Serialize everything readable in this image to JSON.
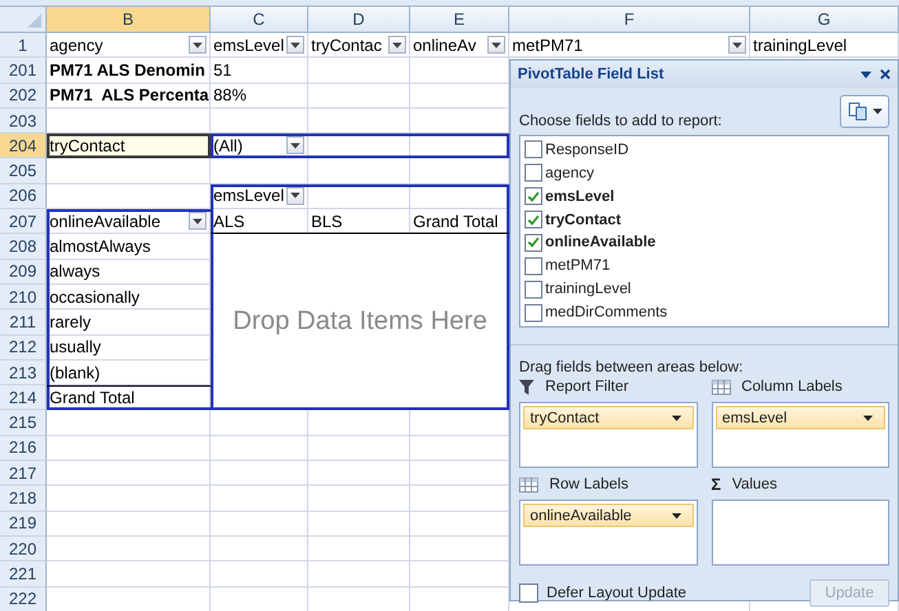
{
  "sheet": {
    "columns": [
      {
        "label": "B"
      },
      {
        "label": "C"
      },
      {
        "label": "D"
      },
      {
        "label": "E"
      },
      {
        "label": "F"
      },
      {
        "label": "G"
      }
    ],
    "rows": [
      {
        "number": "1",
        "cells": [
          {
            "text": "agency",
            "bold": false,
            "dropdown": true,
            "selected": false
          },
          {
            "text": "emsLevel",
            "bold": false,
            "dropdown": true,
            "selected": false
          },
          {
            "text": "tryContac",
            "bold": false,
            "dropdown": true,
            "selected": false
          },
          {
            "text": "onlineAv",
            "bold": false,
            "dropdown": true,
            "selected": false
          },
          {
            "text": "metPM71",
            "bold": false,
            "dropdown": true,
            "selected": false
          },
          {
            "text": "trainingLevel",
            "bold": false,
            "dropdown": false,
            "selected": false
          }
        ]
      },
      {
        "number": "201",
        "cells": [
          {
            "text": "PM71 ALS Denomin",
            "bold": true,
            "dropdown": false,
            "selected": false
          },
          {
            "text": "51",
            "bold": false,
            "dropdown": false,
            "selected": false
          }
        ]
      },
      {
        "number": "202",
        "cells": [
          {
            "text": "PM71  ALS Percenta",
            "bold": true,
            "dropdown": false,
            "selected": false
          },
          {
            "text": "88%",
            "bold": false,
            "dropdown": false,
            "selected": false
          }
        ]
      },
      {
        "number": "203",
        "cells": []
      },
      {
        "number": "204",
        "cells": [
          {
            "text": "tryContact",
            "bold": false,
            "dropdown": false,
            "selected": true
          },
          {
            "text": "(All)",
            "bold": false,
            "dropdown": true,
            "selected": false
          }
        ]
      },
      {
        "number": "205",
        "cells": []
      },
      {
        "number": "206",
        "cells": [
          null,
          {
            "text": "emsLevel",
            "bold": false,
            "dropdown": true,
            "selected": false
          }
        ]
      },
      {
        "number": "207",
        "cells": [
          {
            "text": "onlineAvailable",
            "bold": false,
            "dropdown": true,
            "selected": false
          },
          {
            "text": "ALS",
            "bold": false,
            "dropdown": false,
            "selected": false
          },
          {
            "text": "BLS",
            "bold": false,
            "dropdown": false,
            "selected": false
          },
          {
            "text": "Grand Total",
            "bold": false,
            "dropdown": false,
            "selected": false
          }
        ]
      },
      {
        "number": "208",
        "cells": [
          {
            "text": "almostAlways",
            "bold": false,
            "dropdown": false,
            "selected": false
          }
        ]
      },
      {
        "number": "209",
        "cells": [
          {
            "text": "always",
            "bold": false,
            "dropdown": false,
            "selected": false
          }
        ]
      },
      {
        "number": "210",
        "cells": [
          {
            "text": "occasionally",
            "bold": false,
            "dropdown": false,
            "selected": false
          }
        ]
      },
      {
        "number": "211",
        "cells": [
          {
            "text": "rarely",
            "bold": false,
            "dropdown": false,
            "selected": false
          }
        ]
      },
      {
        "number": "212",
        "cells": [
          {
            "text": "usually",
            "bold": false,
            "dropdown": false,
            "selected": false
          }
        ]
      },
      {
        "number": "213",
        "cells": [
          {
            "text": "(blank)",
            "bold": false,
            "dropdown": false,
            "selected": false
          }
        ]
      },
      {
        "number": "214",
        "cells": [
          {
            "text": "Grand Total",
            "bold": false,
            "dropdown": false,
            "selected": false
          }
        ]
      },
      {
        "number": "215",
        "cells": []
      },
      {
        "number": "216",
        "cells": []
      },
      {
        "number": "217",
        "cells": []
      },
      {
        "number": "218",
        "cells": []
      },
      {
        "number": "219",
        "cells": []
      },
      {
        "number": "220",
        "cells": []
      },
      {
        "number": "221",
        "cells": []
      },
      {
        "number": "222",
        "cells": []
      }
    ],
    "drop_zone": "Drop Data Items Here"
  },
  "field_list": {
    "title": "PivotTable Field List",
    "choose_label": "Choose fields to add to report:",
    "fields": [
      {
        "name": "ResponseID",
        "checked": false
      },
      {
        "name": "agency",
        "checked": false
      },
      {
        "name": "emsLevel",
        "checked": true
      },
      {
        "name": "tryContact",
        "checked": true
      },
      {
        "name": "onlineAvailable",
        "checked": true
      },
      {
        "name": "metPM71",
        "checked": false
      },
      {
        "name": "trainingLevel",
        "checked": false
      },
      {
        "name": "medDirComments",
        "checked": false
      }
    ],
    "areas_label": "Drag fields between areas below:",
    "areas": [
      {
        "kind": "filter",
        "title": "Report Filter",
        "items": [
          "tryContact"
        ]
      },
      {
        "kind": "columns",
        "title": "Column Labels",
        "items": [
          "emsLevel"
        ]
      },
      {
        "kind": "rows",
        "title": "Row Labels",
        "items": [
          "onlineAvailable"
        ]
      },
      {
        "kind": "values",
        "symbol": "Σ",
        "title": "Values"
      }
    ],
    "defer": {
      "label": "Defer Layout Update",
      "checked": false
    },
    "update": {
      "label": "Update",
      "disabled": true
    }
  }
}
